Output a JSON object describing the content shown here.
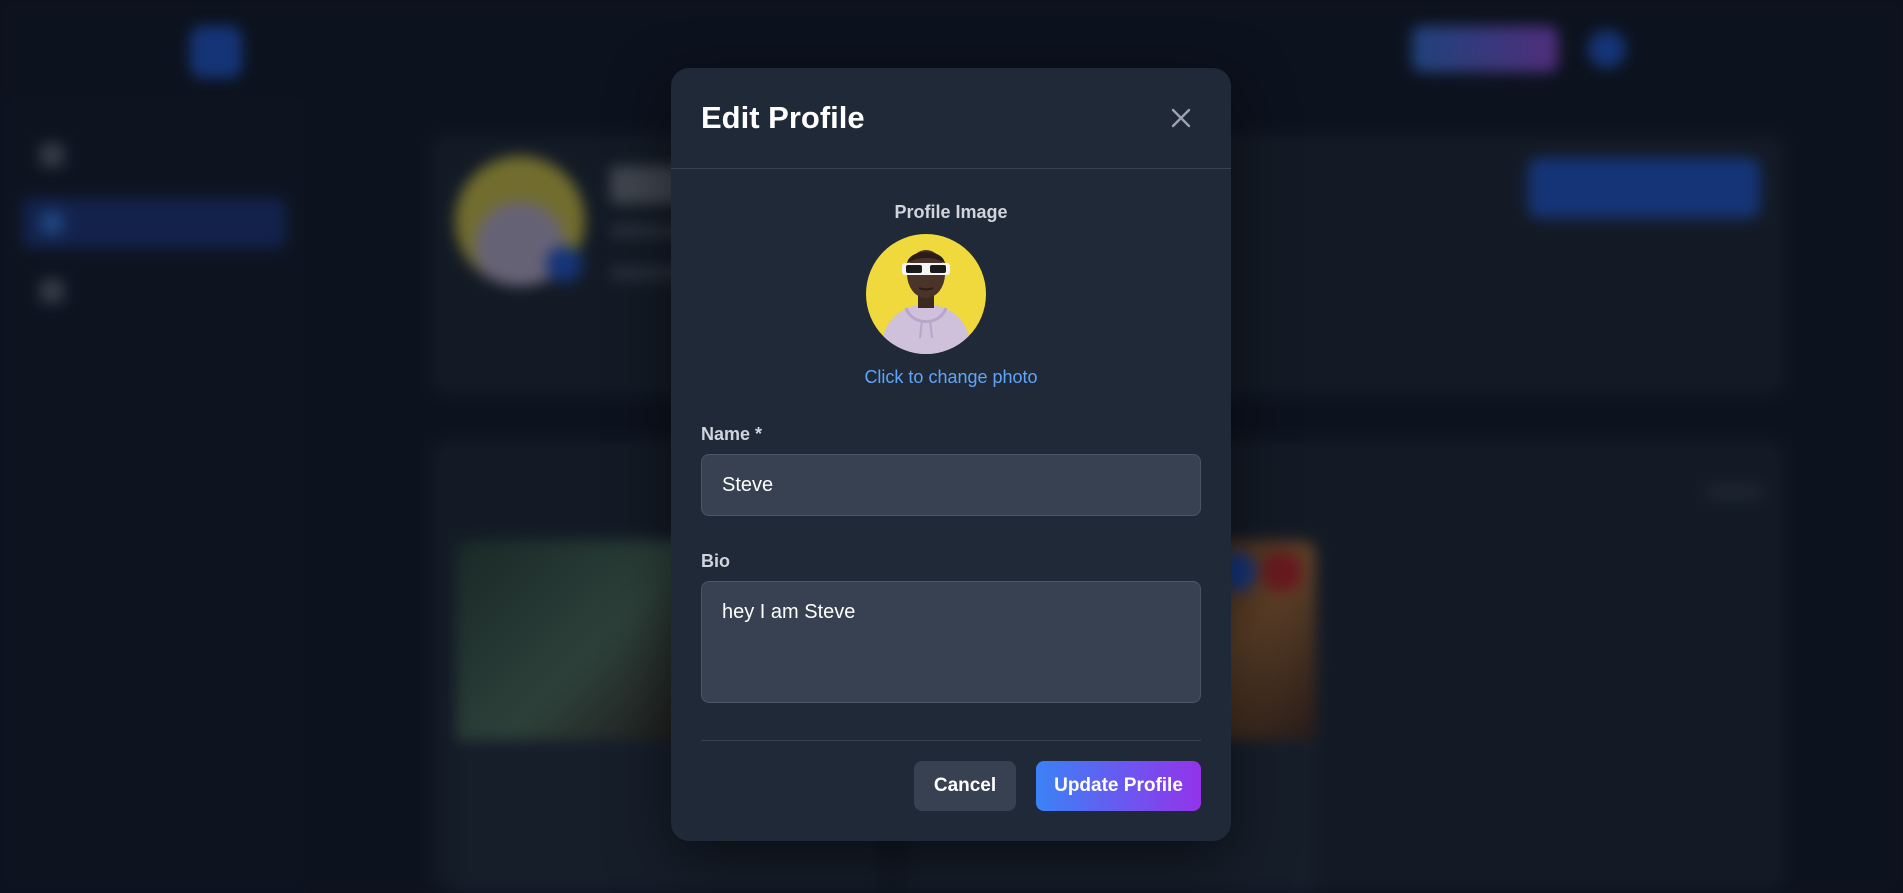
{
  "modal": {
    "title": "Edit Profile",
    "profile_image_label": "Profile Image",
    "change_photo_text": "Click to change photo",
    "name_label": "Name *",
    "name_value": "Steve",
    "bio_label": "Bio",
    "bio_value": "hey I am Steve",
    "cancel_label": "Cancel",
    "submit_label": "Update Profile",
    "close_icon": "close-icon"
  },
  "colors": {
    "accent_start": "#3b82f6",
    "accent_end": "#9333ea",
    "link": "#60a5fa",
    "modal_bg": "#1f2937"
  }
}
